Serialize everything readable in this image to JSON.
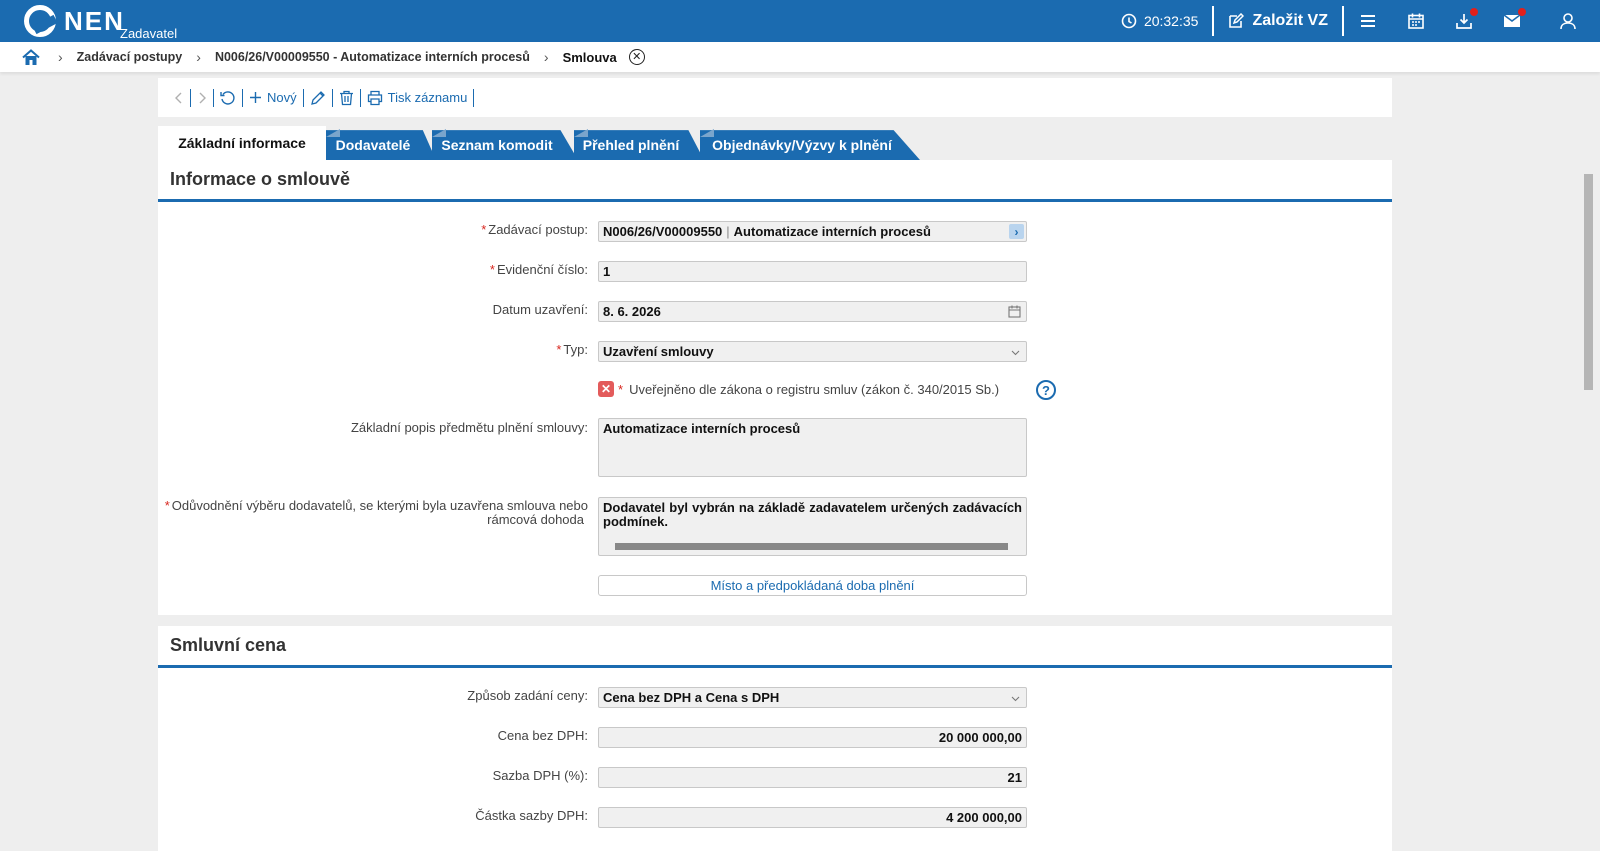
{
  "header": {
    "logo_text": "NEN",
    "logo_sub": "Zadavatel",
    "time": "20:32:35",
    "create_label": "Založit VZ"
  },
  "breadcrumb": {
    "items": [
      "Zadávací postupy",
      "N006/26/V00009550 - Automatizace interních procesů"
    ],
    "current": "Smlouva"
  },
  "toolbar": {
    "new_label": "Nový",
    "print_label": "Tisk záznamu"
  },
  "tabs": [
    "Základní informace",
    "Dodavatelé",
    "Seznam komodit",
    "Přehled plnění",
    "Objednávky/Výzvy k plnění"
  ],
  "contract_info": {
    "title": "Informace o smlouvě",
    "procedure_label": "Zadávací postup:",
    "procedure_code": "N006/26/V00009550",
    "procedure_name": "Automatizace interních procesů",
    "evidence_label": "Evidenční číslo:",
    "evidence_value": "1",
    "date_label": "Datum uzavření:",
    "date_value": "8. 6. 2026",
    "type_label": "Typ:",
    "type_value": "Uzavření smlouvy",
    "published_label": "Uveřejněno dle zákona o registru smluv (zákon č. 340/2015 Sb.)",
    "description_label": "Základní popis předmětu plnění smlouvy:",
    "description_value": "Automatizace interních procesů",
    "justification_label_1": "Odůvodnění výběru dodavatelů, se kterými byla uzavřena smlouva nebo",
    "justification_label_2": "rámcová dohoda",
    "justification_value": "Dodavatel byl vybrán na základě zadavatelem určených zadávacích podmínek.",
    "place_button": "Místo a předpokládaná doba plnění"
  },
  "price": {
    "title": "Smluvní cena",
    "method_label": "Způsob zadání ceny:",
    "method_value": "Cena bez DPH a Cena s DPH",
    "net_label": "Cena bez DPH:",
    "net_value": "20 000 000,00",
    "vat_rate_label": "Sazba DPH (%):",
    "vat_rate_value": "21",
    "vat_amount_label": "Částka sazby DPH:",
    "vat_amount_value": "4 200 000,00"
  },
  "colors": {
    "primary": "#1b6bb0",
    "required": "#d8261e",
    "notification": "#e0201c"
  }
}
